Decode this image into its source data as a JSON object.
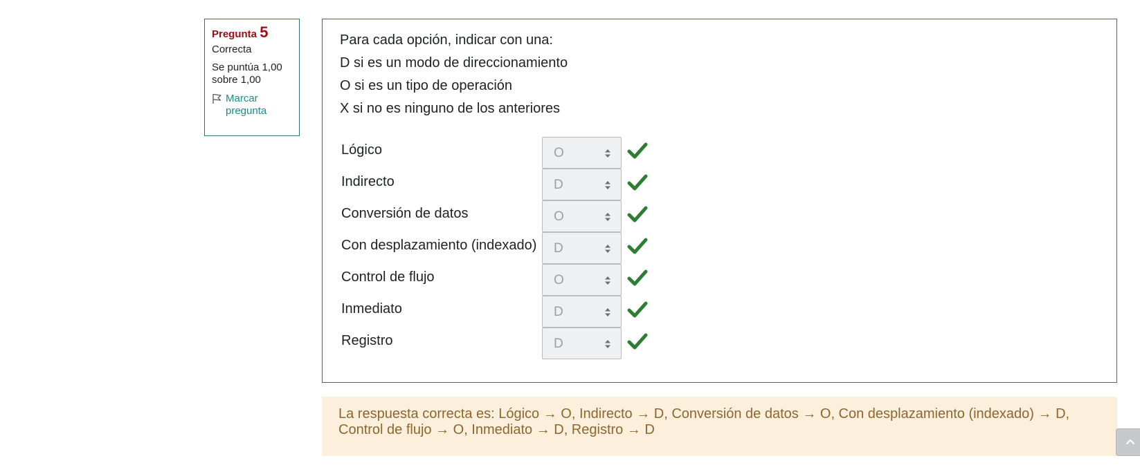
{
  "info": {
    "title_prefix": "Pregunta",
    "number": "5",
    "state": "Correcta",
    "grade": "Se puntúa 1,00 sobre 1,00",
    "flag_label": "Marcar pregunta"
  },
  "question": {
    "lines": [
      "Para cada opción, indicar con una:",
      "D si es un modo de direccionamiento",
      "O si es un tipo de operación",
      "X si no es ninguno de los anteriores"
    ],
    "items": [
      {
        "label": "Lógico",
        "value": "O",
        "status": "correct"
      },
      {
        "label": "Indirecto",
        "value": "D",
        "status": "correct"
      },
      {
        "label": "Conversión de datos",
        "value": "O",
        "status": "correct"
      },
      {
        "label": "Con desplazamiento (indexado)",
        "value": "D",
        "status": "correct"
      },
      {
        "label": "Control de flujo",
        "value": "O",
        "status": "correct"
      },
      {
        "label": "Inmediato",
        "value": "D",
        "status": "correct"
      },
      {
        "label": "Registro",
        "value": "D",
        "status": "correct"
      }
    ]
  },
  "feedback": {
    "text": "La respuesta correcta es: Lógico → O, Indirecto → D, Conversión de datos → O, Con desplazamiento (indexado) → D, Control de flujo → O, Inmediato → D, Registro → D"
  },
  "colors": {
    "accent_border": "#2f6f7a",
    "question_title": "#a00d14",
    "check": "#2e7d32",
    "feedback_bg": "#fcefdc",
    "feedback_text": "#8e662e"
  },
  "icons": {
    "flag": "flag-icon",
    "check": "check-icon",
    "select_arrows": "sort-arrows-icon",
    "scroll_top": "chevron-up-icon"
  }
}
